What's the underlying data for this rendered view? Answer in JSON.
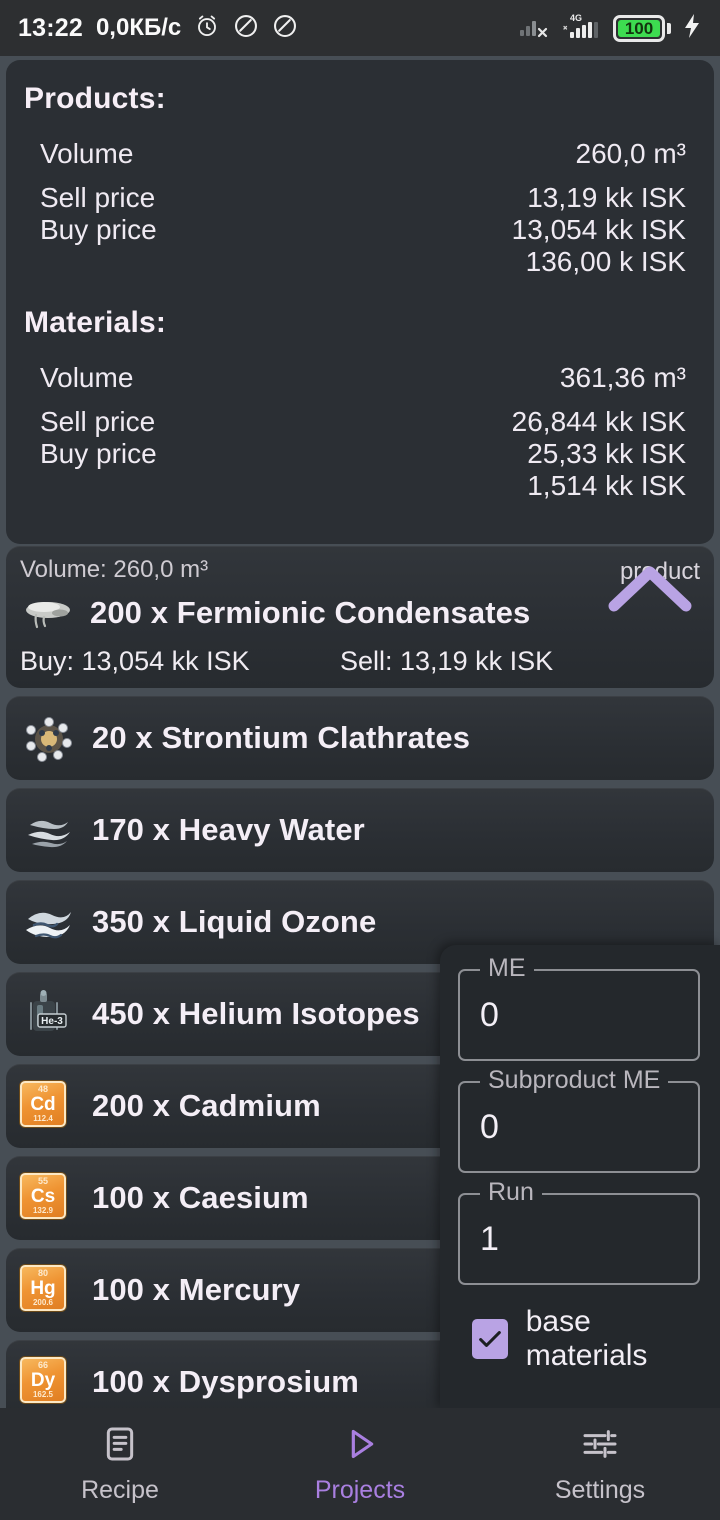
{
  "statusbar": {
    "time": "13:22",
    "network_speed": "0,0КБ/с",
    "alarm_icon": "alarm-clock-icon",
    "mute_icon_1": "do-not-disturb-icon",
    "mute_icon_2": "do-not-disturb-icon",
    "signal_no_service_icon": "signal-no-service-icon",
    "signal_icon": "signal-bars-icon",
    "network_type": "4G",
    "battery_percent": "100",
    "battery_color": "#3ddc50",
    "charging_icon": "charging-bolt-icon"
  },
  "summary": {
    "products": {
      "title": "Products:",
      "rows": [
        {
          "key": "Volume",
          "value": "260,0 m³"
        },
        {
          "key": "Sell price",
          "value": "13,19 kk ISK"
        },
        {
          "key": "Buy price",
          "value": "13,054 kk ISK"
        }
      ],
      "extra_value": "136,00 k ISK"
    },
    "materials": {
      "title": "Materials:",
      "rows": [
        {
          "key": "Volume",
          "value": "361,36 m³"
        },
        {
          "key": "Sell price",
          "value": "26,844 kk ISK"
        },
        {
          "key": "Buy price",
          "value": "25,33 kk ISK"
        }
      ],
      "extra_value": "1,514 kk ISK"
    }
  },
  "product_card": {
    "volume_line": "Volume: 260,0 m³",
    "tag": "product",
    "collapse_icon": "chevron-up-icon",
    "icon": "fermionic-condensates-icon",
    "name": "200 x Fermionic Condensates",
    "buy": "Buy: 13,054 kk ISK",
    "sell": "Sell: 13,19 kk ISK"
  },
  "materials_list": [
    {
      "name": "20 x Strontium Clathrates",
      "icon": "strontium-clathrates-icon",
      "icon_type": "molecule"
    },
    {
      "name": "170 x Heavy Water",
      "icon": "heavy-water-icon",
      "icon_type": "liquid"
    },
    {
      "name": "350 x Liquid Ozone",
      "icon": "liquid-ozone-icon",
      "icon_type": "liquid"
    },
    {
      "name": "450 x Helium Isotopes",
      "icon": "helium-isotopes-icon",
      "icon_type": "canister",
      "badge": "He-3"
    },
    {
      "name": "200 x Cadmium",
      "icon": "cadmium-element-icon",
      "icon_type": "element",
      "element_number": "48",
      "element_symbol": "Cd",
      "element_mass": "112.4"
    },
    {
      "name": "100 x Caesium",
      "icon": "caesium-element-icon",
      "icon_type": "element",
      "element_number": "55",
      "element_symbol": "Cs",
      "element_mass": "132.9"
    },
    {
      "name": "100 x Mercury",
      "icon": "mercury-element-icon",
      "icon_type": "element",
      "element_number": "80",
      "element_symbol": "Hg",
      "element_mass": "200.6"
    },
    {
      "name": "100 x Dysprosium",
      "icon": "dysprosium-element-icon",
      "icon_type": "element",
      "element_number": "66",
      "element_symbol": "Dy",
      "element_mass": "162.5",
      "expand_icon": "chevron-right-icon"
    }
  ],
  "panel": {
    "me": {
      "label": "ME",
      "value": "0"
    },
    "subproduct_me": {
      "label": "Subproduct ME",
      "value": "0"
    },
    "run": {
      "label": "Run",
      "value": "1"
    },
    "base_materials": {
      "label": "base materials",
      "checked": true,
      "color": "#b9a3e4"
    }
  },
  "bottom_nav": {
    "accent": "#a97fe0",
    "items": [
      {
        "label": "Recipe",
        "icon": "document-list-icon",
        "active": false
      },
      {
        "label": "Projects",
        "icon": "play-triangle-icon",
        "active": true
      },
      {
        "label": "Settings",
        "icon": "tune-sliders-icon",
        "active": false
      }
    ]
  }
}
